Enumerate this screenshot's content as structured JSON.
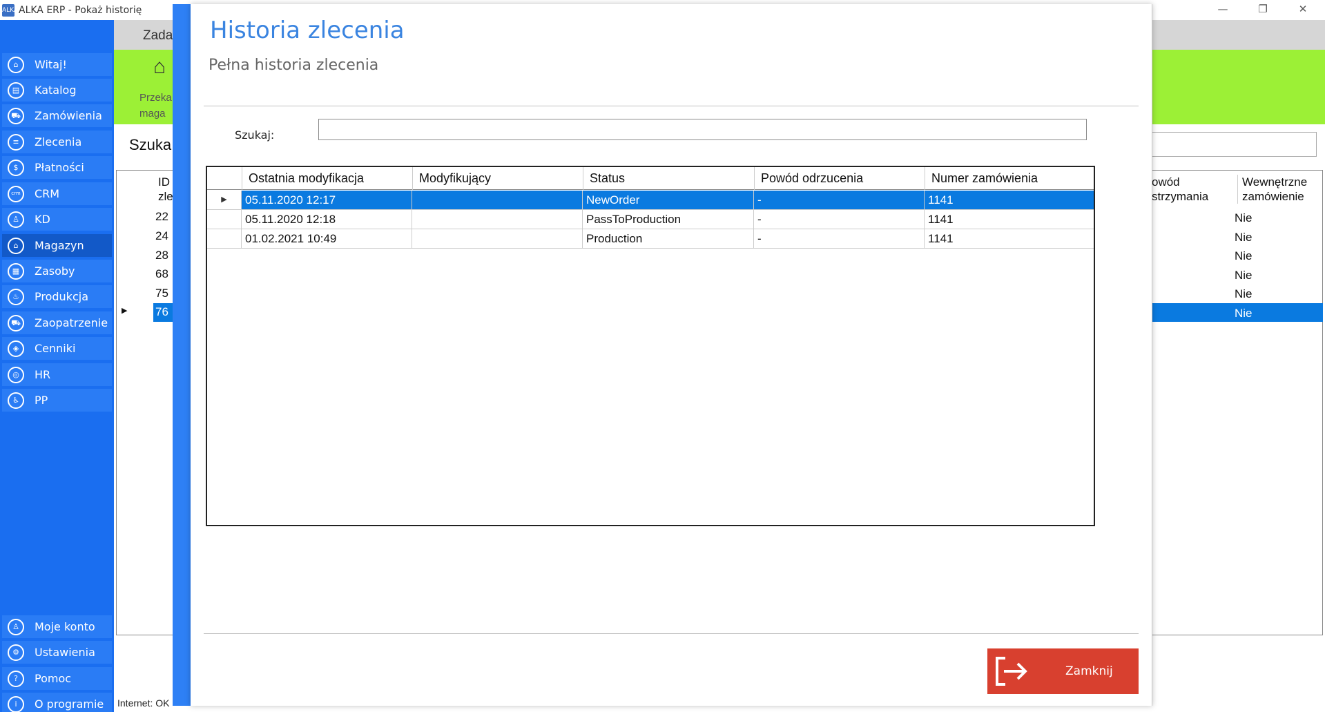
{
  "window": {
    "title": "ALKA ERP - Pokaż historię",
    "minimize_glyph": "—",
    "maximize_glyph": "❐",
    "close_glyph": "✕",
    "app_icon_text": "ALKA"
  },
  "sidebar": {
    "items": [
      {
        "label": "Witaj!",
        "icon": "home-icon",
        "glyph": "⌂"
      },
      {
        "label": "Katalog",
        "icon": "book-icon",
        "glyph": "▤"
      },
      {
        "label": "Zamówienia",
        "icon": "cart-icon",
        "glyph": "⛟"
      },
      {
        "label": "Zlecenia",
        "icon": "list-icon",
        "glyph": "≡"
      },
      {
        "label": "Płatności",
        "icon": "dollar-icon",
        "glyph": "$"
      },
      {
        "label": "CRM",
        "icon": "crm-icon",
        "glyph": "crm"
      },
      {
        "label": "KD",
        "icon": "person-icon",
        "glyph": "♙"
      },
      {
        "label": "Magazyn",
        "icon": "warehouse-icon",
        "glyph": "⌂"
      },
      {
        "label": "Zasoby",
        "icon": "resources-icon",
        "glyph": "▦"
      },
      {
        "label": "Produkcja",
        "icon": "production-icon",
        "glyph": "♨"
      },
      {
        "label": "Zaopatrzenie",
        "icon": "truck-icon",
        "glyph": "⛟"
      },
      {
        "label": "Cenniki",
        "icon": "tag-icon",
        "glyph": "◈"
      },
      {
        "label": "HR",
        "icon": "hr-icon",
        "glyph": "◎"
      },
      {
        "label": "PP",
        "icon": "pp-icon",
        "glyph": "♿"
      }
    ],
    "bottom_items": [
      {
        "label": "Moje konto",
        "icon": "account-icon",
        "glyph": "♙"
      },
      {
        "label": "Ustawienia",
        "icon": "settings-icon",
        "glyph": "⚙"
      },
      {
        "label": "Pomoc",
        "icon": "help-icon",
        "glyph": "?"
      },
      {
        "label": "O programie",
        "icon": "info-icon",
        "glyph": "i"
      }
    ]
  },
  "background": {
    "tab_label": "Zada",
    "ribbon_label_line1": "Przeka",
    "ribbon_label_line2": "maga",
    "search_label": "Szuka",
    "grid": {
      "col1_header_line1": "ID",
      "col1_header_line2": "zle",
      "col_right_header_line1": "owód",
      "col_right_header_line2": "strzymania",
      "col_last_header_line1": "Wewnętrzne",
      "col_last_header_line2": "zamówienie",
      "ids": [
        "22",
        "24",
        "28",
        "68",
        "75",
        "76"
      ],
      "last_values": [
        "Nie",
        "Nie",
        "Nie",
        "Nie",
        "Nie",
        "Nie"
      ]
    },
    "statusbar": "Internet: OK"
  },
  "modal": {
    "title": "Historia zlecenia",
    "subtitle": "Pełna historia zlecenia",
    "search_label": "Szukaj:",
    "search_value": "",
    "columns": [
      "Ostatnia modyfikacja",
      "Modyfikujący",
      "Status",
      "Powód odrzucenia",
      "Numer zamówienia"
    ],
    "rows": [
      {
        "date": "05.11.2020 12:17",
        "user": "",
        "status": "NewOrder",
        "reason": "-",
        "order": "1141"
      },
      {
        "date": "05.11.2020 12:18",
        "user": "",
        "status": "PassToProduction",
        "reason": "-",
        "order": "1141"
      },
      {
        "date": "01.02.2021 10:49",
        "user": "",
        "status": "Production",
        "reason": "-",
        "order": "1141"
      }
    ],
    "selected_indicator": "▶",
    "close_label": "Zamknij"
  },
  "colors": {
    "sidebar": "#1a6ef0",
    "ribbon": "#9cf036",
    "accent": "#2e80f5",
    "selection": "#0a7ae0",
    "close_button": "#d8402f"
  }
}
